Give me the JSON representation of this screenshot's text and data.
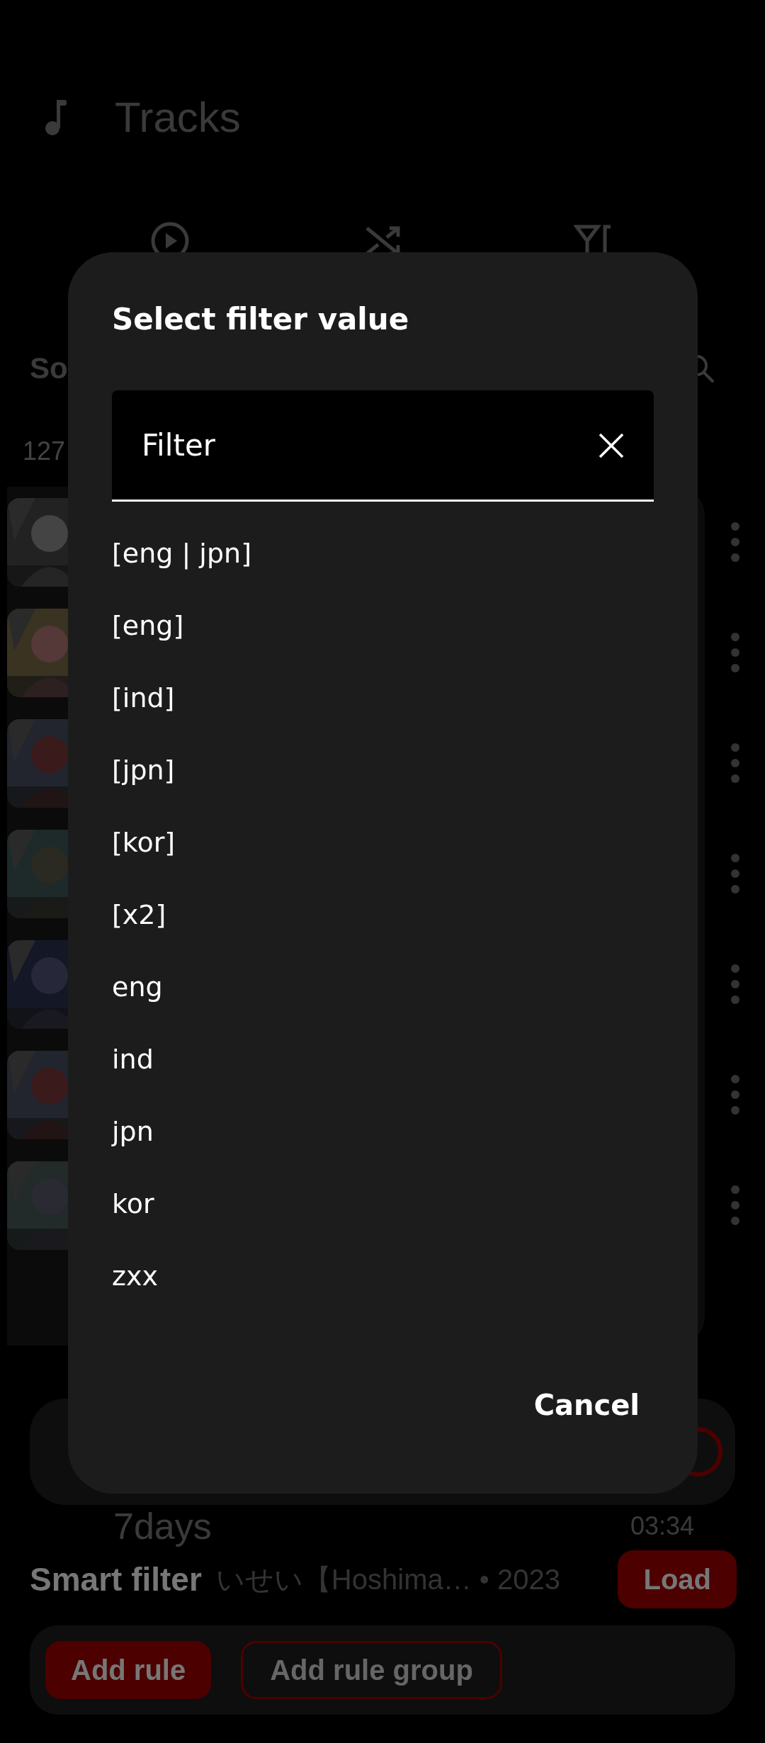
{
  "app_bar": {
    "title": "Tracks"
  },
  "toolbar": {
    "buttons": [
      {
        "kind": "play"
      },
      {
        "kind": "shuffle"
      },
      {
        "kind": "filter"
      }
    ]
  },
  "sort_label": "So",
  "count": "127",
  "smart_filter": {
    "partial_track": {
      "title": "7days",
      "subtitle": "いせい【Hoshima…  • 2023",
      "duration": "03:34"
    },
    "title": "Smart filter",
    "load": "Load",
    "add_rule": "Add rule",
    "add_rule_group": "Add rule group"
  },
  "dialog": {
    "title": "Select filter value",
    "field": {
      "placeholder": "Filter"
    },
    "options": [
      "[eng | jpn]",
      "[eng]",
      "[ind]",
      "[jpn]",
      "[kor]",
      "[x2]",
      "eng",
      "ind",
      "jpn",
      "kor",
      "zxx"
    ],
    "cancel": "Cancel"
  }
}
